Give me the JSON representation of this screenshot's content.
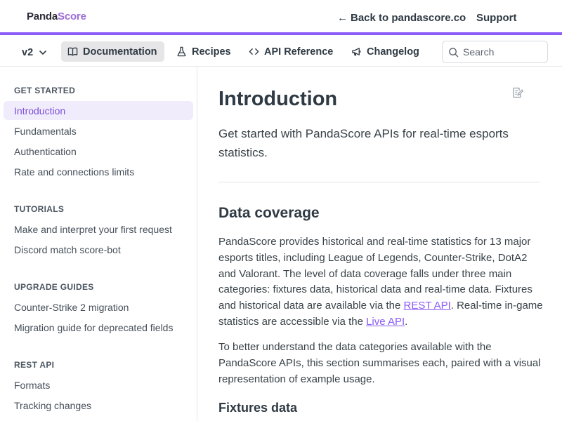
{
  "header": {
    "logo_panda": "Panda",
    "logo_score": "Score",
    "back_arrow": "←",
    "back_label": "Back to pandascore.co",
    "support_label": "Support",
    "accent_color": "#8b5cf6"
  },
  "subnav": {
    "version": "v2",
    "tabs": [
      {
        "label": "Documentation",
        "icon": "book-icon",
        "active": true
      },
      {
        "label": "Recipes",
        "icon": "flask-icon",
        "active": false
      },
      {
        "label": "API Reference",
        "icon": "code-icon",
        "active": false
      },
      {
        "label": "Changelog",
        "icon": "megaphone-icon",
        "active": false
      }
    ],
    "search_placeholder": "Search"
  },
  "sidebar": {
    "sections": [
      {
        "title": "GET STARTED",
        "items": [
          "Introduction",
          "Fundamentals",
          "Authentication",
          "Rate and connections limits"
        ]
      },
      {
        "title": "TUTORIALS",
        "items": [
          "Make and interpret your first request",
          "Discord match score-bot"
        ]
      },
      {
        "title": "UPGRADE GUIDES",
        "items": [
          "Counter-Strike 2 migration",
          "Migration guide for deprecated fields"
        ]
      },
      {
        "title": "REST API",
        "items": [
          "Formats",
          "Tracking changes"
        ]
      }
    ],
    "active_item": "Introduction"
  },
  "main": {
    "title": "Introduction",
    "subtitle": "Get started with PandaScore APIs for real-time esports statistics.",
    "section_heading": "Data coverage",
    "para1_text_a": "PandaScore provides historical and real-time statistics for 13 major esports titles, including League of Legends, Counter-Strike, DotA2 and Valorant. The level of data coverage falls under three main categories: fixtures data, historical data and real-time data. Fixtures and historical data are available via the ",
    "para1_link1": "REST API",
    "para1_text_b": ". Real-time in-game statistics are accessible via the ",
    "para1_link2": "Live API",
    "para1_text_c": ".",
    "para2": "To better understand the data categories available with the PandaScore APIs, this section summarises each, paired with a visual representation of example usage.",
    "subheading": "Fixtures data"
  }
}
